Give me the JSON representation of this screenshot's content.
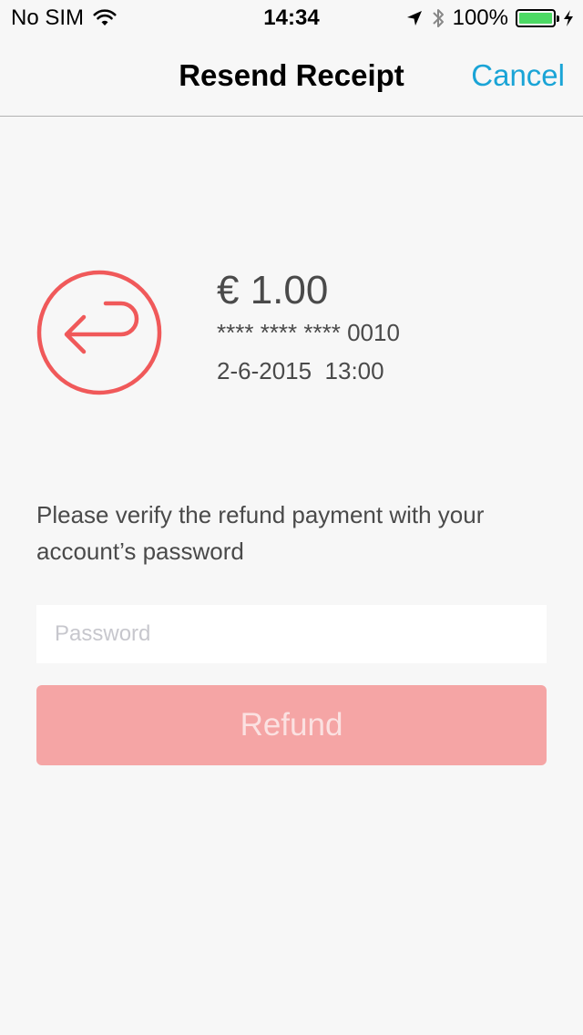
{
  "status_bar": {
    "carrier": "No SIM",
    "time": "14:34",
    "battery": "100%",
    "icons": [
      "wifi-icon",
      "location-arrow-icon",
      "bluetooth-icon",
      "battery-icon",
      "charging-bolt-icon"
    ],
    "battery_color": "#4cd964"
  },
  "nav": {
    "title": "Resend Receipt",
    "cancel_label": "Cancel",
    "accent_color": "#1aa4d6"
  },
  "transaction": {
    "icon": "refund-return-arrow-icon",
    "icon_color": "#f0595a",
    "amount": "€ 1.00",
    "card_number": "**** **** **** 0010",
    "date_time": "2-6-2015  13:00"
  },
  "verify": {
    "message": "Please verify the refund payment with your account’s password"
  },
  "password": {
    "placeholder": "Password",
    "value": ""
  },
  "refund_button": {
    "label": "Refund",
    "color": "#f5a5a5"
  }
}
